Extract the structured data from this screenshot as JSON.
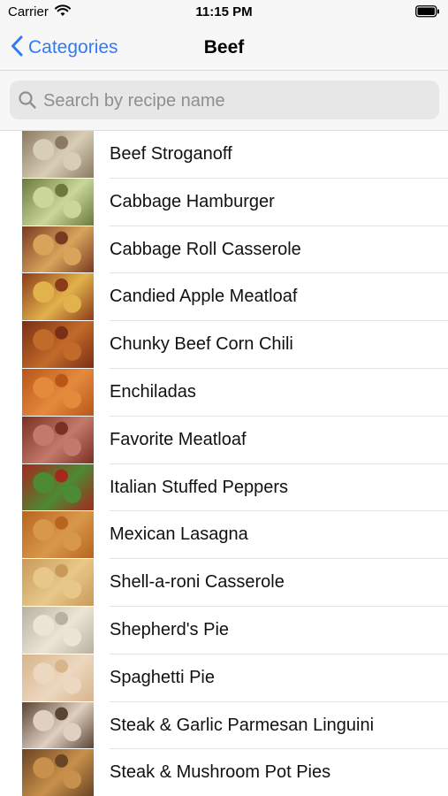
{
  "status": {
    "carrier": "Carrier",
    "time": "11:15 PM"
  },
  "nav": {
    "back_label": "Categories",
    "title": "Beef"
  },
  "search": {
    "placeholder": "Search by recipe name",
    "value": ""
  },
  "colors": {
    "accent": "#2f7cf6"
  },
  "recipes": [
    {
      "name": "Beef Stroganoff",
      "thumb": [
        "#8a7a62",
        "#d8cdb6"
      ]
    },
    {
      "name": "Cabbage Hamburger",
      "thumb": [
        "#6b7a3a",
        "#c9d79a"
      ]
    },
    {
      "name": "Cabbage Roll Casserole",
      "thumb": [
        "#7a3a22",
        "#d8a45a"
      ]
    },
    {
      "name": "Candied Apple Meatloaf",
      "thumb": [
        "#8c3b18",
        "#e2b24c"
      ]
    },
    {
      "name": "Chunky Beef Corn Chili",
      "thumb": [
        "#7a2e14",
        "#c26a2a"
      ]
    },
    {
      "name": "Enchiladas",
      "thumb": [
        "#b8561a",
        "#e48a3c"
      ]
    },
    {
      "name": "Favorite Meatloaf",
      "thumb": [
        "#7a3024",
        "#c27a6a"
      ]
    },
    {
      "name": "Italian Stuffed Peppers",
      "thumb": [
        "#a4281c",
        "#4c8a34"
      ]
    },
    {
      "name": "Mexican Lasagna",
      "thumb": [
        "#b8641e",
        "#d8984a"
      ]
    },
    {
      "name": "Shell-a-roni Casserole",
      "thumb": [
        "#c89a5a",
        "#e8c88a"
      ]
    },
    {
      "name": "Shepherd's Pie",
      "thumb": [
        "#b8b0a0",
        "#ece4d4"
      ]
    },
    {
      "name": "Spaghetti Pie",
      "thumb": [
        "#d8b48a",
        "#ecd8c0"
      ]
    },
    {
      "name": "Steak & Garlic Parmesan Linguini",
      "thumb": [
        "#5a4434",
        "#e0d0c0"
      ]
    },
    {
      "name": "Steak & Mushroom Pot Pies",
      "thumb": [
        "#6a4424",
        "#c8904a"
      ]
    }
  ]
}
